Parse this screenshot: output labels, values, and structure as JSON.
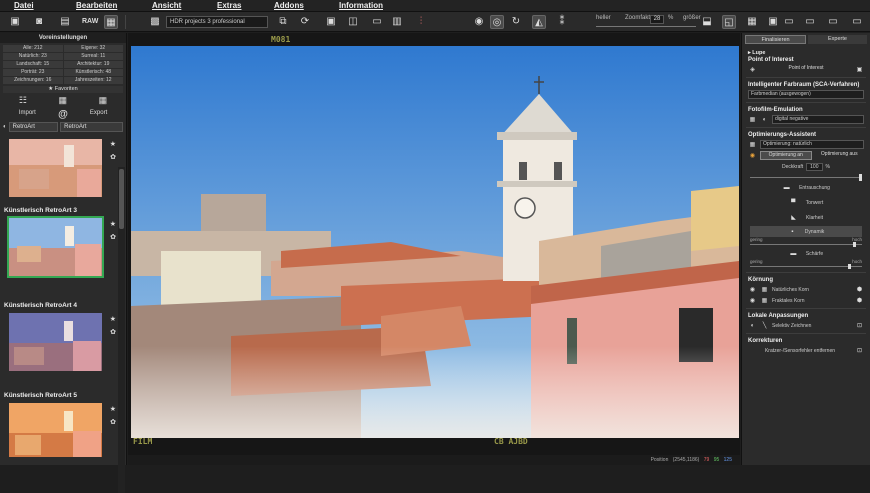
{
  "menu": [
    "Datei",
    "Bearbeiten",
    "Ansicht",
    "Extras",
    "Addons",
    "Information"
  ],
  "toolbar": {
    "raw_label": "RAW",
    "preset_value": "HDR projects 3 professional",
    "heller_label": "heller",
    "zoom_label": "Zoomfaktor",
    "zoom_value": "28",
    "zoom_unit": "%",
    "groesser_label": "größer"
  },
  "left": {
    "panel_title": "Voreinstellungen",
    "categories": [
      "Alle: 212",
      "Eigene: 32",
      "Natürlich: 23",
      "Surreal: 11",
      "Landschaft: 15",
      "Architektur: 19",
      "Porträt: 23",
      "Künstlerisch: 48",
      "Zeichnungen: 16",
      "Jahreszeiten: 12"
    ],
    "favorites": "Favoriten",
    "import": "Import",
    "at": "@",
    "export": "Export",
    "preset_group": "RetroArt",
    "preset_select": "RetroArt",
    "thumbs": [
      "Künstlerisch RetroArt 3",
      "Künstlerisch RetroArt 4",
      "Künstlerisch RetroArt 5"
    ]
  },
  "canvas": {
    "top_stamp": "M081",
    "bottom_left_stamp": "FILM",
    "bottom_mid_stamp": "CB AJBD"
  },
  "status": {
    "position_label": "Position",
    "position_value": "(2545,1186)",
    "r": "79",
    "g": "95",
    "b": "125"
  },
  "right": {
    "tabs": [
      "Finalisieren",
      "Experte"
    ],
    "lupe": "Lupe",
    "poi_title": "Point of Interest",
    "poi_button": "Point of Interest",
    "sca_title": "Intelligenter Farbraum (SCA-Verfahren)",
    "sca_value": "Farbmedian (ausgewogen)",
    "film_title": "Fotofilm-Emulation",
    "film_value": "digital negative",
    "opt_title": "Optimierungs-Assistent",
    "opt_value": "Optimierung: natürlich",
    "opt_on": "Optimierung an",
    "opt_off": "Optimierung aus",
    "deckkraft_label": "Deckkraft",
    "deckkraft_value": "100",
    "deckkraft_unit": "%",
    "deckkraft_level": 1.0,
    "tools": [
      "Entrauschung",
      "Tonwert",
      "Klarheit",
      "Dynamik",
      "Schärfe"
    ],
    "gering": "gering",
    "hoch": "hoch",
    "slider1_level": 0.95,
    "slider2_level": 0.9,
    "koernung_title": "Körnung",
    "natural_grain": "Natürliches Korn",
    "fractal_grain": "Fraktales Korn",
    "lokal_title": "Lokale Anpassungen",
    "selektiv": "Selektiv Zeichnen",
    "korrekturen_title": "Korrekturen",
    "kratzer": "Kratzer-/Sensorfehler entfernen"
  },
  "colors": {
    "accent_green": "#34a853",
    "sky": "#4a8fd6",
    "roof": "#c8643c"
  }
}
